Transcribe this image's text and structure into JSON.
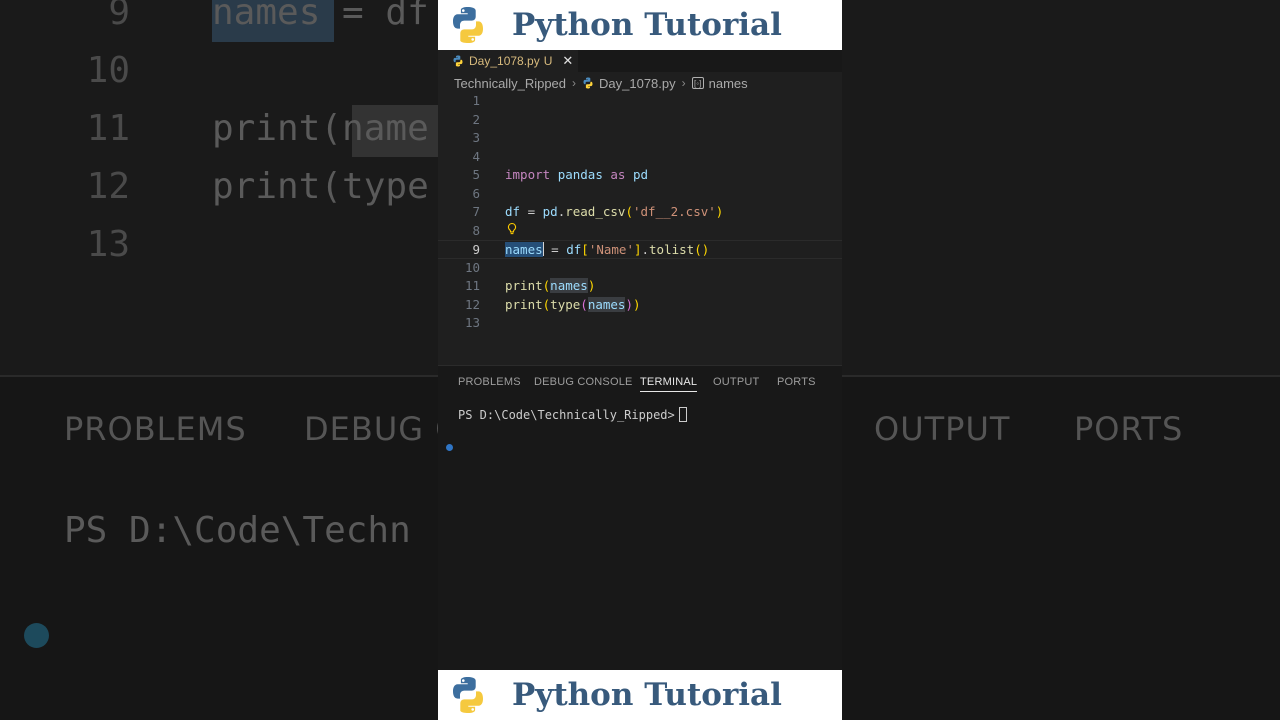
{
  "banner": {
    "title": "Python Tutorial"
  },
  "editor_tab": {
    "filename": "Day_1078.py",
    "modified": "U"
  },
  "breadcrumb": {
    "folder": "Technically_Ripped",
    "file": "Day_1078.py",
    "symbol": "names"
  },
  "line_numbers": [
    "1",
    "2",
    "3",
    "4",
    "5",
    "6",
    "7",
    "8",
    "9",
    "10",
    "11",
    "12",
    "13"
  ],
  "code": {
    "l5": {
      "k1": "import",
      "m": "pandas",
      "k2": "as",
      "a": "pd"
    },
    "l7": {
      "v": "df",
      "eq": " = ",
      "obj": "pd",
      "dot": ".",
      "fn": "read_csv",
      "op": "(",
      "s": "'df__2.csv'",
      "cp": ")"
    },
    "l9": {
      "v": "names",
      "eq": " = ",
      "obj": "df",
      "ob": "[",
      "s": "'Name'",
      "cb": "]",
      "dot": ".",
      "fn": "tolist",
      "p": "()"
    },
    "l11": {
      "fn": "print",
      "op": "(",
      "arg": "names",
      "cp": ")"
    },
    "l12": {
      "fn": "print",
      "op": "(",
      "fn2": "type",
      "op2": "(",
      "arg": "names",
      "cp2": ")",
      "cp": ")"
    }
  },
  "panel": {
    "tabs": [
      "PROBLEMS",
      "DEBUG CONSOLE",
      "TERMINAL",
      "OUTPUT",
      "PORTS"
    ],
    "active_tab": "TERMINAL",
    "terminal_prompt": "PS D:\\Code\\Technically_Ripped>"
  },
  "background": {
    "line9": "names",
    "line9_rest": " = df",
    "line11": "print(name",
    "line12": "print(type",
    "nums": [
      "9",
      "10",
      "11",
      "12",
      "13"
    ],
    "tab_problems": "PROBLEMS",
    "tab_debug": "DEBUG C",
    "tab_output": "OUTPUT",
    "tab_ports": "PORTS",
    "term": "PS D:\\Code\\Techn"
  },
  "colors": {
    "banner_title": "#385a7c",
    "keyword": "#c586c0",
    "variable": "#9cdcfe",
    "function": "#dcdcaa",
    "string": "#ce9178"
  }
}
